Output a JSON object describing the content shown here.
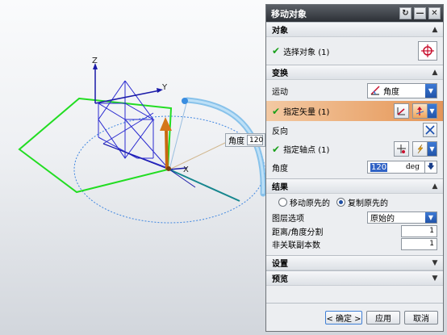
{
  "viewport": {
    "axis_z": "Z",
    "axis_y": "Y",
    "axis_x": "X",
    "angle_tip_label": "角度",
    "angle_tip_value": "120"
  },
  "dialog": {
    "title": "移动对象",
    "object_section": {
      "title": "对象",
      "select_label": "选择对象 (1)"
    },
    "transform_section": {
      "title": "变换",
      "motion_label": "运动",
      "motion_value": "角度",
      "vector_label": "指定矢量 (1)",
      "reverse_label": "反向",
      "pivot_label": "指定轴点 (1)",
      "angle_label": "角度",
      "angle_value": "120",
      "angle_unit": "deg"
    },
    "result_section": {
      "title": "结果",
      "move_original": "移动原先的",
      "copy_original": "复制原先的",
      "layer_label": "图层选项",
      "layer_value": "原始的",
      "distance_label": "距离/角度分割",
      "distance_value": "1",
      "copies_label": "非关联副本数",
      "copies_value": "1"
    },
    "settings_section": {
      "title": "设置"
    },
    "preview_section": {
      "title": "预览"
    },
    "buttons": {
      "ok": "< 确定 >",
      "apply": "应用",
      "cancel": "取消"
    }
  }
}
